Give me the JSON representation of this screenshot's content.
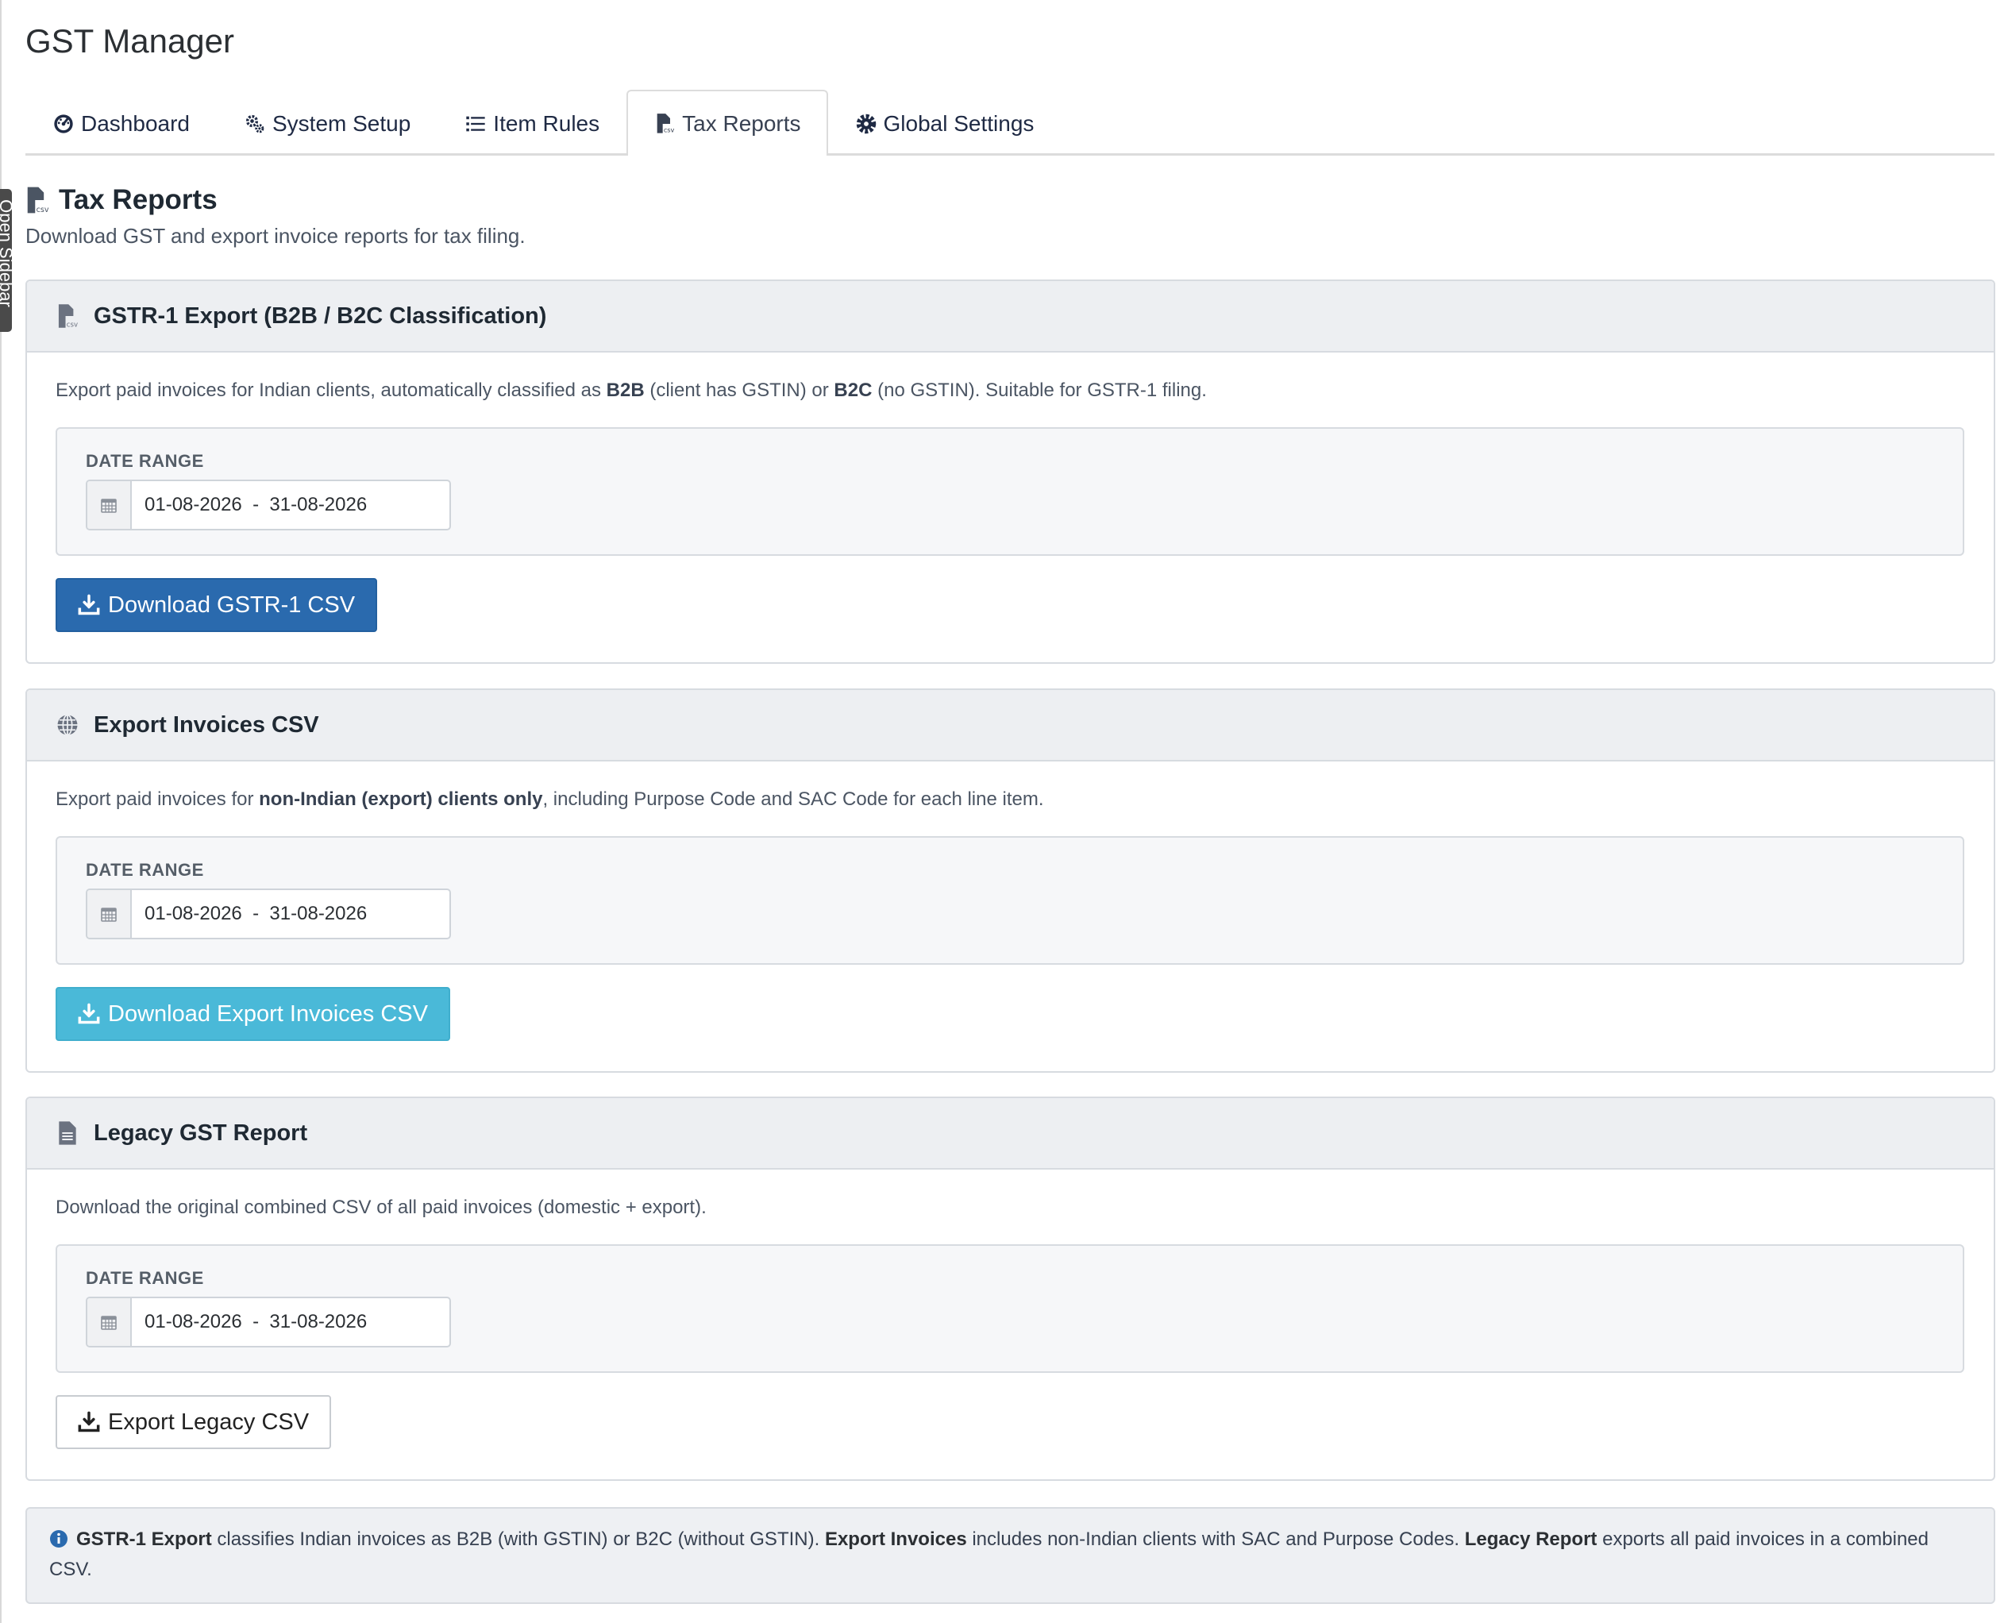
{
  "app": {
    "title": "GST Manager"
  },
  "sidebar_toggle": {
    "label": "Open Sidebar"
  },
  "tabs": [
    {
      "label": "Dashboard",
      "icon": "dashboard-icon"
    },
    {
      "label": "System Setup",
      "icon": "gears-icon"
    },
    {
      "label": "Item Rules",
      "icon": "list-icon"
    },
    {
      "label": "Tax Reports",
      "icon": "file-csv-icon",
      "active": true
    },
    {
      "label": "Global Settings",
      "icon": "gear-icon"
    }
  ],
  "page": {
    "title": "Tax Reports",
    "subtitle": "Download GST and export invoice reports for tax filing."
  },
  "cards": [
    {
      "title": "GSTR-1 Export (B2B / B2C Classification)",
      "icon": "file-csv-icon",
      "desc_1": "Export paid invoices for Indian clients, automatically classified as ",
      "desc_b1": "B2B",
      "desc_2": " (client has GSTIN) or ",
      "desc_b2": "B2C",
      "desc_3": " (no GSTIN). Suitable for GSTR-1 filing.",
      "range_label": "DATE RANGE",
      "range_value": "01-08-2026  -  31-08-2026",
      "button_label": "Download GSTR-1 CSV"
    },
    {
      "title": "Export Invoices CSV",
      "icon": "globe-icon",
      "desc_1": "Export paid invoices for ",
      "desc_b1": "non-Indian (export) clients only",
      "desc_2": ", including Purpose Code and SAC Code for each line item.",
      "range_label": "DATE RANGE",
      "range_value": "01-08-2026  -  31-08-2026",
      "button_label": "Download Export Invoices CSV"
    },
    {
      "title": "Legacy GST Report",
      "icon": "file-text-icon",
      "desc_1": "Download the original combined CSV of all paid invoices (domestic + export).",
      "range_label": "DATE RANGE",
      "range_value": "01-08-2026  -  31-08-2026",
      "button_label": "Export Legacy CSV"
    }
  ],
  "note": {
    "b1": "GSTR-1 Export",
    "t1": " classifies Indian invoices as B2B (with GSTIN) or B2C (without GSTIN). ",
    "b2": "Export Invoices",
    "t2": " includes non-Indian clients with SAC and Purpose Codes. ",
    "b3": "Legacy Report",
    "t3": " exports all paid invoices in a combined CSV."
  },
  "colors": {
    "primary_button": "#2a6aae",
    "info_button": "#4ab9d8",
    "header_bg": "#edeff2"
  }
}
